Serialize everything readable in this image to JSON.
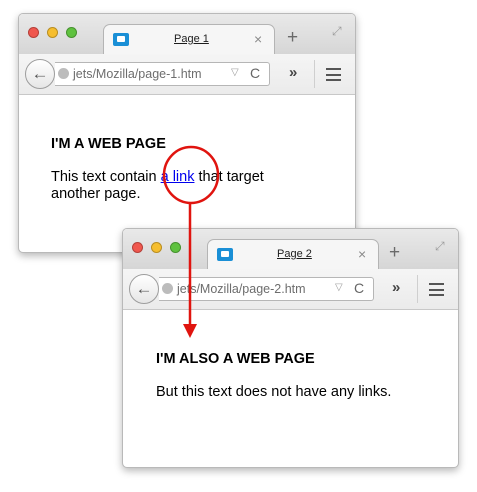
{
  "window1": {
    "tab_title": "Page 1",
    "tab_close": "×",
    "new_tab": "+",
    "url": "jets/Mozilla/page-1.htm",
    "back_glyph": "←",
    "reload_glyph": "C",
    "dropdown_glyph": "▽",
    "overflow_glyph": "»",
    "heading": "I'M A WEB PAGE",
    "text_before_link": "This text contain ",
    "link_text": "a link",
    "text_after_link": " that target",
    "text_line2": "another page."
  },
  "window2": {
    "tab_title": "Page 2",
    "tab_close": "×",
    "new_tab": "+",
    "url": "jets/Mozilla/page-2.htm",
    "back_glyph": "←",
    "reload_glyph": "C",
    "dropdown_glyph": "▽",
    "overflow_glyph": "»",
    "heading": "I'M ALSO A WEB PAGE",
    "text": "But this text does not have any links."
  },
  "colors": {
    "annotation_red": "#e0140f",
    "link_blue": "#0000ee"
  },
  "icons": {
    "tab_favicon": "tab-favicon-icon",
    "globe": "globe-icon",
    "fullscreen": "fullscreen-icon",
    "menu": "hamburger-menu-icon"
  }
}
